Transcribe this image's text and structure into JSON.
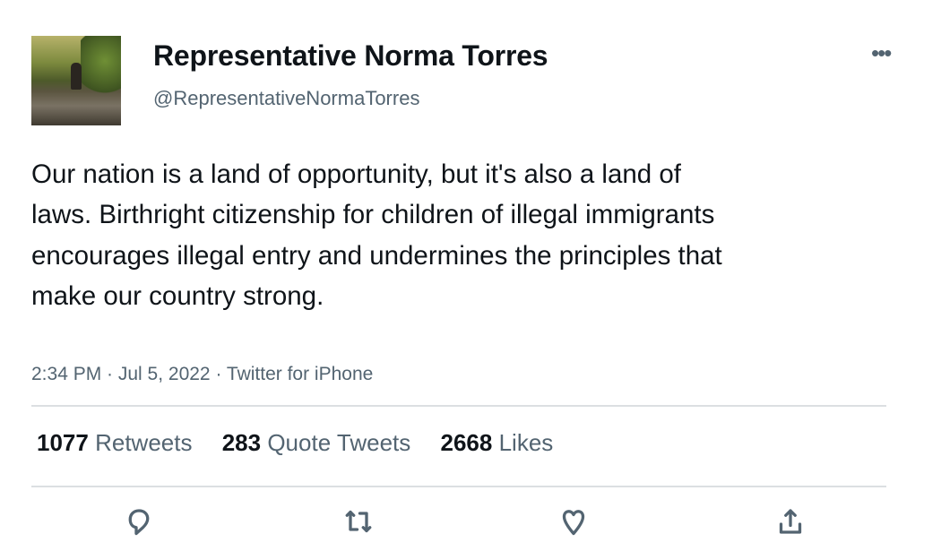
{
  "author": {
    "name": "Representative Norma Torres",
    "handle": "@RepresentativeNormaTorres"
  },
  "tweet": {
    "text": "Our nation is a land of opportunity, but it's also a land of laws. Birthright citizenship for children of illegal immigrants encourages illegal entry and undermines the principles that make our country strong.",
    "meta": "2:34 PM · Jul 5, 2022 · Twitter for iPhone"
  },
  "stats": [
    {
      "count": "1077",
      "label": "Retweets"
    },
    {
      "count": "283",
      "label": "Quote Tweets"
    },
    {
      "count": "2668",
      "label": "Likes"
    }
  ],
  "more_label": "•••",
  "icons": [
    "reply-icon",
    "retweet-icon",
    "like-icon",
    "share-icon"
  ]
}
